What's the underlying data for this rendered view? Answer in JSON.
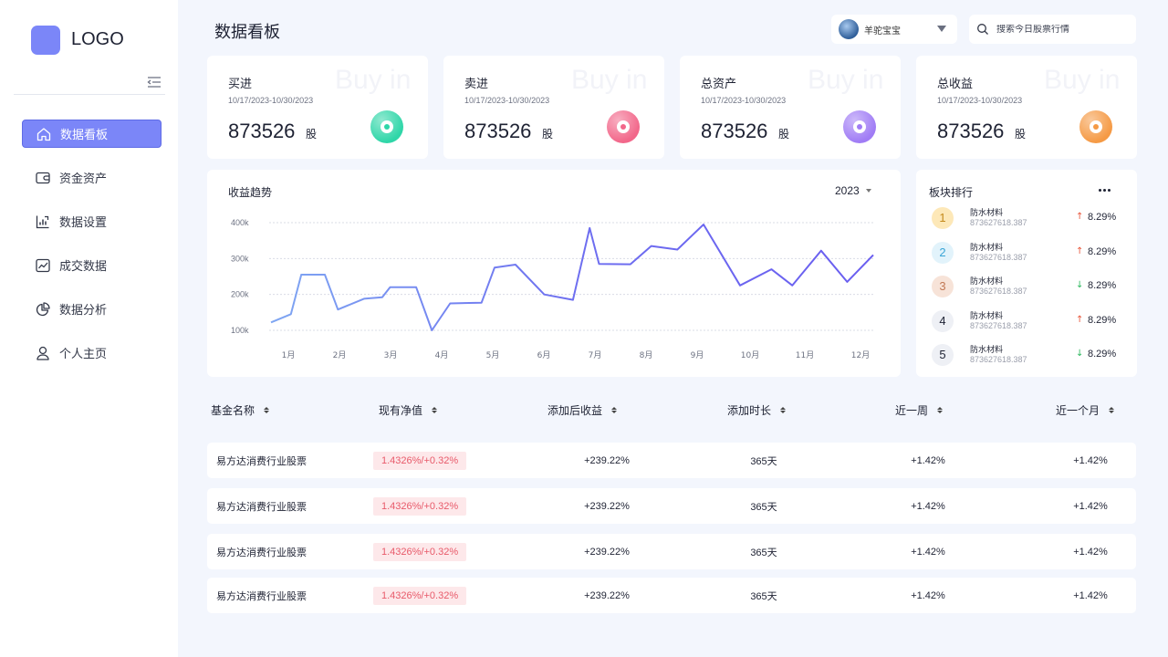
{
  "app": {
    "logo_text": "LOGO",
    "page_title": "数据看板"
  },
  "sidebar": {
    "items": [
      {
        "label": "数据看板",
        "icon": "home-icon",
        "active": true
      },
      {
        "label": "资金资产",
        "icon": "wallet-icon",
        "active": false
      },
      {
        "label": "数据设置",
        "icon": "bar-chart-icon",
        "active": false
      },
      {
        "label": "成交数据",
        "icon": "line-chart-icon",
        "active": false
      },
      {
        "label": "数据分析",
        "icon": "pie-chart-icon",
        "active": false
      },
      {
        "label": "个人主页",
        "icon": "user-icon",
        "active": false
      }
    ]
  },
  "header": {
    "user_name": "羊驼宝宝",
    "search_placeholder": "搜索今日股票行情"
  },
  "stats": [
    {
      "title": "买进",
      "ghost": "Buy in",
      "date_range": "10/17/2023-10/30/2023",
      "value": "873526",
      "unit": "股",
      "icon_color": "#2fd6a8"
    },
    {
      "title": "卖进",
      "ghost": "Buy in",
      "date_range": "10/17/2023-10/30/2023",
      "value": "873526",
      "unit": "股",
      "icon_color": "#f2678a"
    },
    {
      "title": "总资产",
      "ghost": "Buy in",
      "date_range": "10/17/2023-10/30/2023",
      "value": "873526",
      "unit": "股",
      "icon_color": "#a07cf5"
    },
    {
      "title": "总收益",
      "ghost": "Buy in",
      "date_range": "10/17/2023-10/30/2023",
      "value": "873526",
      "unit": "股",
      "icon_color": "#f59a45"
    }
  ],
  "trend": {
    "title": "收益趋势",
    "year": "2023"
  },
  "chart_data": {
    "type": "line",
    "title": "收益趋势",
    "y_ticks": [
      "100k",
      "200k",
      "300k",
      "400k"
    ],
    "x_ticks": [
      "1月",
      "2月",
      "3月",
      "4月",
      "5月",
      "6月",
      "7月",
      "8月",
      "9月",
      "10月",
      "11月",
      "12月"
    ],
    "ylim": [
      100000,
      400000
    ],
    "grid": true,
    "points": [
      {
        "x": 0.72,
        "y": 122000
      },
      {
        "x": 1.1,
        "y": 145000
      },
      {
        "x": 1.3,
        "y": 255000
      },
      {
        "x": 1.75,
        "y": 255000
      },
      {
        "x": 2.0,
        "y": 158000
      },
      {
        "x": 2.5,
        "y": 188000
      },
      {
        "x": 2.85,
        "y": 192000
      },
      {
        "x": 3.0,
        "y": 220000
      },
      {
        "x": 3.5,
        "y": 220000
      },
      {
        "x": 3.8,
        "y": 100000
      },
      {
        "x": 4.15,
        "y": 175000
      },
      {
        "x": 4.75,
        "y": 177000
      },
      {
        "x": 5.0,
        "y": 275000
      },
      {
        "x": 5.4,
        "y": 283000
      },
      {
        "x": 5.95,
        "y": 200000
      },
      {
        "x": 6.5,
        "y": 185000
      },
      {
        "x": 6.82,
        "y": 385000
      },
      {
        "x": 7.0,
        "y": 285000
      },
      {
        "x": 7.6,
        "y": 284000
      },
      {
        "x": 8.0,
        "y": 335000
      },
      {
        "x": 8.5,
        "y": 325000
      },
      {
        "x": 9.0,
        "y": 395000
      },
      {
        "x": 9.7,
        "y": 225000
      },
      {
        "x": 10.3,
        "y": 270000
      },
      {
        "x": 10.7,
        "y": 225000
      },
      {
        "x": 11.25,
        "y": 322000
      },
      {
        "x": 11.75,
        "y": 235000
      },
      {
        "x": 12.25,
        "y": 310000
      }
    ],
    "line_color": "#6e6ff0"
  },
  "ranking": {
    "title": "板块排行",
    "items": [
      {
        "rank": "1",
        "name": "防水材料",
        "code": "873627618.387",
        "change": "8.29%",
        "direction": "up",
        "badge_bg": "#fde8b8",
        "badge_fg": "#c48a1c"
      },
      {
        "rank": "2",
        "name": "防水材料",
        "code": "873627618.387",
        "change": "8.29%",
        "direction": "up",
        "badge_bg": "#e2f3fb",
        "badge_fg": "#3aa5d6"
      },
      {
        "rank": "3",
        "name": "防水材料",
        "code": "873627618.387",
        "change": "8.29%",
        "direction": "down",
        "badge_bg": "#f7e3d8",
        "badge_fg": "#c27955"
      },
      {
        "rank": "4",
        "name": "防水材料",
        "code": "873627618.387",
        "change": "8.29%",
        "direction": "up",
        "badge_bg": "#eef0f5",
        "badge_fg": "#1e2233"
      },
      {
        "rank": "5",
        "name": "防水材料",
        "code": "873627618.387",
        "change": "8.29%",
        "direction": "down",
        "badge_bg": "#eef0f5",
        "badge_fg": "#1e2233"
      }
    ],
    "up_color": "#e8553a",
    "down_color": "#2fb85f"
  },
  "table": {
    "headers": [
      "基金名称",
      "现有净值",
      "添加后收益",
      "添加时长",
      "近一周",
      "近一个月"
    ],
    "rows": [
      [
        "易方达消费行业股票",
        "1.4326%/+0.32%",
        "+239.22%",
        "365天",
        "+1.42%",
        "+1.42%"
      ],
      [
        "易方达消费行业股票",
        "1.4326%/+0.32%",
        "+239.22%",
        "365天",
        "+1.42%",
        "+1.42%"
      ],
      [
        "易方达消费行业股票",
        "1.4326%/+0.32%",
        "+239.22%",
        "365天",
        "+1.42%",
        "+1.42%"
      ],
      [
        "易方达消费行业股票",
        "1.4326%/+0.32%",
        "+239.22%",
        "365天",
        "+1.42%",
        "+1.42%"
      ]
    ]
  }
}
